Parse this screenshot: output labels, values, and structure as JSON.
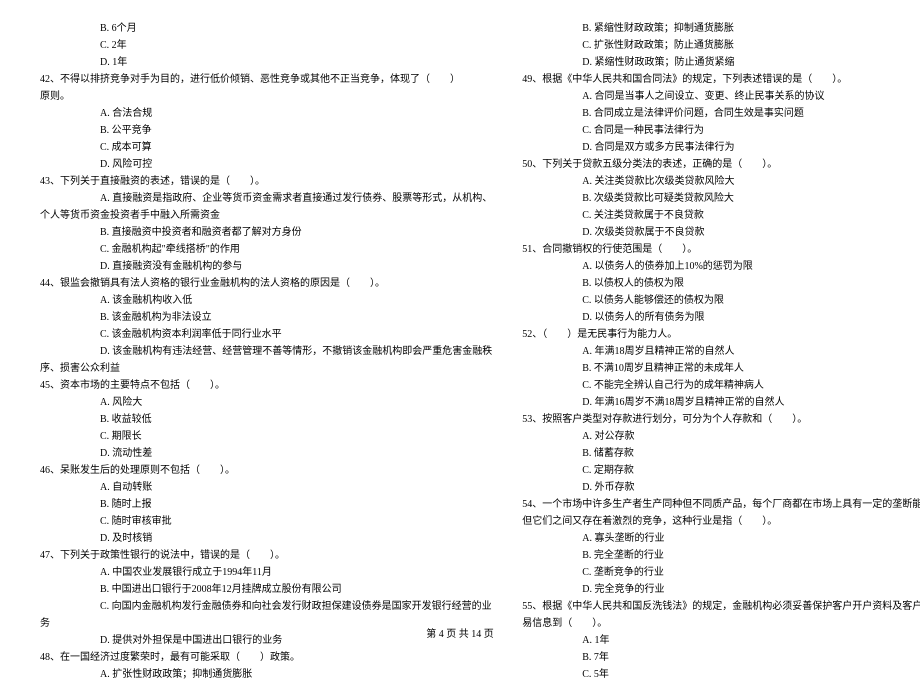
{
  "leftColumn": {
    "preOptions": [
      "B. 6个月",
      "C. 2年",
      "D. 1年"
    ],
    "q42": {
      "text": "42、不得以排挤竞争对手为目的，进行低价倾销、恶性竞争或其他不正当竞争，体现了（　　）",
      "cont": "原则。",
      "options": [
        "A. 合法合规",
        "B. 公平竞争",
        "C. 成本可算",
        "D. 风险可控"
      ]
    },
    "q43": {
      "text": "43、下列关于直接融资的表述，错误的是（　　）。",
      "options": [
        "A. 直接融资是指政府、企业等货币资金需求者直接通过发行债券、股票等形式，从机构、",
        "B. 直接融资中投资者和融资者都了解对方身份",
        "C. 金融机构起\"牵线搭桥\"的作用",
        "D. 直接融资没有金融机构的参与"
      ],
      "contAfterA": "个人等货币资金投资者手中融入所需资金"
    },
    "q44": {
      "text": "44、银监会撤销具有法人资格的银行业金融机构的法人资格的原因是（　　）。",
      "options": [
        "A. 该金融机构收入低",
        "B. 该金融机构为非法设立",
        "C. 该金融机构资本利润率低于同行业水平",
        "D. 该金融机构有违法经营、经营管理不善等情形，不撤销该金融机构即会严重危害金融秩"
      ],
      "contAfterD": "序、损害公众利益"
    },
    "q45": {
      "text": "45、资本市场的主要特点不包括（　　）。",
      "options": [
        "A. 风险大",
        "B. 收益较低",
        "C. 期限长",
        "D. 流动性差"
      ]
    },
    "q46": {
      "text": "46、呆账发生后的处理原则不包括（　　）。",
      "options": [
        "A. 自动转账",
        "B. 随时上报",
        "C. 随时审核审批",
        "D. 及时核销"
      ]
    },
    "q47": {
      "text": "47、下列关于政策性银行的说法中，错误的是（　　）。",
      "options": [
        "A. 中国农业发展银行成立于1994年11月",
        "B. 中国进出口银行于2008年12月挂牌成立股份有限公司",
        "C. 向国内金融机构发行金融债券和向社会发行财政担保建设债券是国家开发银行经营的业",
        "D. 提供对外担保是中国进出口银行的业务"
      ],
      "contAfterC": "务"
    },
    "q48": {
      "text": "48、在一国经济过度繁荣时，最有可能采取（　　）政策。",
      "options": [
        "A. 扩张性财政政策；抑制通货膨胀"
      ]
    }
  },
  "rightColumn": {
    "preOptions": [
      "B. 紧缩性财政政策；抑制通货膨胀",
      "C. 扩张性财政政策；防止通货膨胀",
      "D. 紧缩性财政政策；防止通货紧缩"
    ],
    "q49": {
      "text": "49、根据《中华人民共和国合同法》的规定，下列表述错误的是（　　）。",
      "options": [
        "A. 合同是当事人之间设立、变更、终止民事关系的协议",
        "B. 合同成立是法律评价问题，合同生效是事实问题",
        "C. 合同是一种民事法律行为",
        "D. 合同是双方或多方民事法律行为"
      ]
    },
    "q50": {
      "text": "50、下列关于贷款五级分类法的表述，正确的是（　　）。",
      "options": [
        "A. 关注类贷款比次级类贷款风险大",
        "B. 次级类贷款比可疑类贷款风险大",
        "C. 关注类贷款属于不良贷款",
        "D. 次级类贷款属于不良贷款"
      ]
    },
    "q51": {
      "text": "51、合同撤销权的行使范围是（　　）。",
      "options": [
        "A. 以债务人的债券加上10%的惩罚为限",
        "B. 以债权人的债权为限",
        "C. 以债务人能够偿还的债权为限",
        "D. 以债务人的所有债务为限"
      ]
    },
    "q52": {
      "text": "52、（　　）是无民事行为能力人。",
      "options": [
        "A. 年满18周岁且精神正常的自然人",
        "B. 不满10周岁且精神正常的未成年人",
        "C. 不能完全辨认自己行为的成年精神病人",
        "D. 年满16周岁不满18周岁且精神正常的自然人"
      ]
    },
    "q53": {
      "text": "53、按照客户类型对存款进行划分，可分为个人存款和（　　）。",
      "options": [
        "A. 对公存款",
        "B. 储蓄存款",
        "C. 定期存款",
        "D. 外币存款"
      ]
    },
    "q54": {
      "text": "54、一个市场中许多生产者生产同种但不同质产品，每个厂商都在市场上具有一定的垄断能力，",
      "cont": "但它们之间又存在着激烈的竞争，这种行业是指（　　）。",
      "options": [
        "A. 寡头垄断的行业",
        "B. 完全垄断的行业",
        "C. 垄断竞争的行业",
        "D. 完全竞争的行业"
      ]
    },
    "q55": {
      "text": "55、根据《中华人民共和国反洗钱法》的规定，金融机构必须妥善保护客户开户资料及客户交",
      "cont": "易信息到（　　）。",
      "options": [
        "A. 1年",
        "B. 7年",
        "C. 5年"
      ]
    }
  },
  "footer": "第 4 页 共 14 页"
}
